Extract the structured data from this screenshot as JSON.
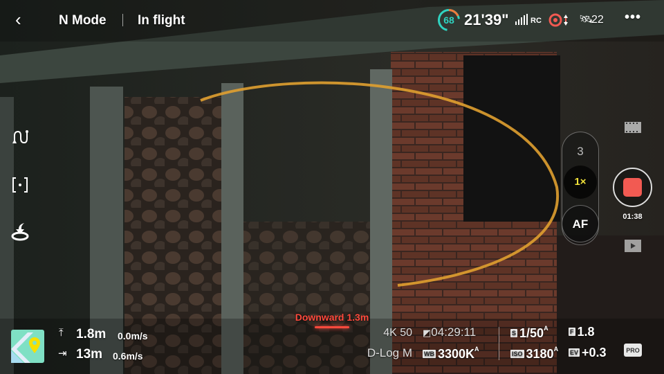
{
  "topbar": {
    "mode": "N Mode",
    "status": "In flight",
    "battery": "68",
    "flight_time": "21'39\"",
    "rc_label": "RC",
    "satellites": "22"
  },
  "camera": {
    "zoom_option": "3",
    "zoom_selected": "1×",
    "af_label": "AF",
    "record_time": "01:38"
  },
  "obstacle": {
    "warning": "Downward 1.3m"
  },
  "telemetry": {
    "altitude": "1.8m",
    "vertical_speed": "0.0m/s",
    "distance": "13m",
    "horizontal_speed": "0.6m/s"
  },
  "settings": {
    "resolution_fps": "4K 50",
    "storage_time": "04:29:11",
    "color_profile": "D-Log M",
    "wb_label": "WB",
    "wb": "3300K",
    "wb_auto": "A",
    "shutter_label": "S",
    "shutter": "1/50",
    "shutter_auto": "A",
    "iso_label": "ISO",
    "iso": "3180",
    "iso_auto": "A",
    "aperture_label": "F",
    "aperture": "1.8",
    "ev_label": "EV",
    "ev": "+0.3",
    "pro_label": "PRO"
  },
  "colors": {
    "accent_yellow": "#f2e33a",
    "record_red": "#f25a52",
    "battery_teal": "#2fd3c0",
    "warning_red": "#ff4a3d"
  }
}
